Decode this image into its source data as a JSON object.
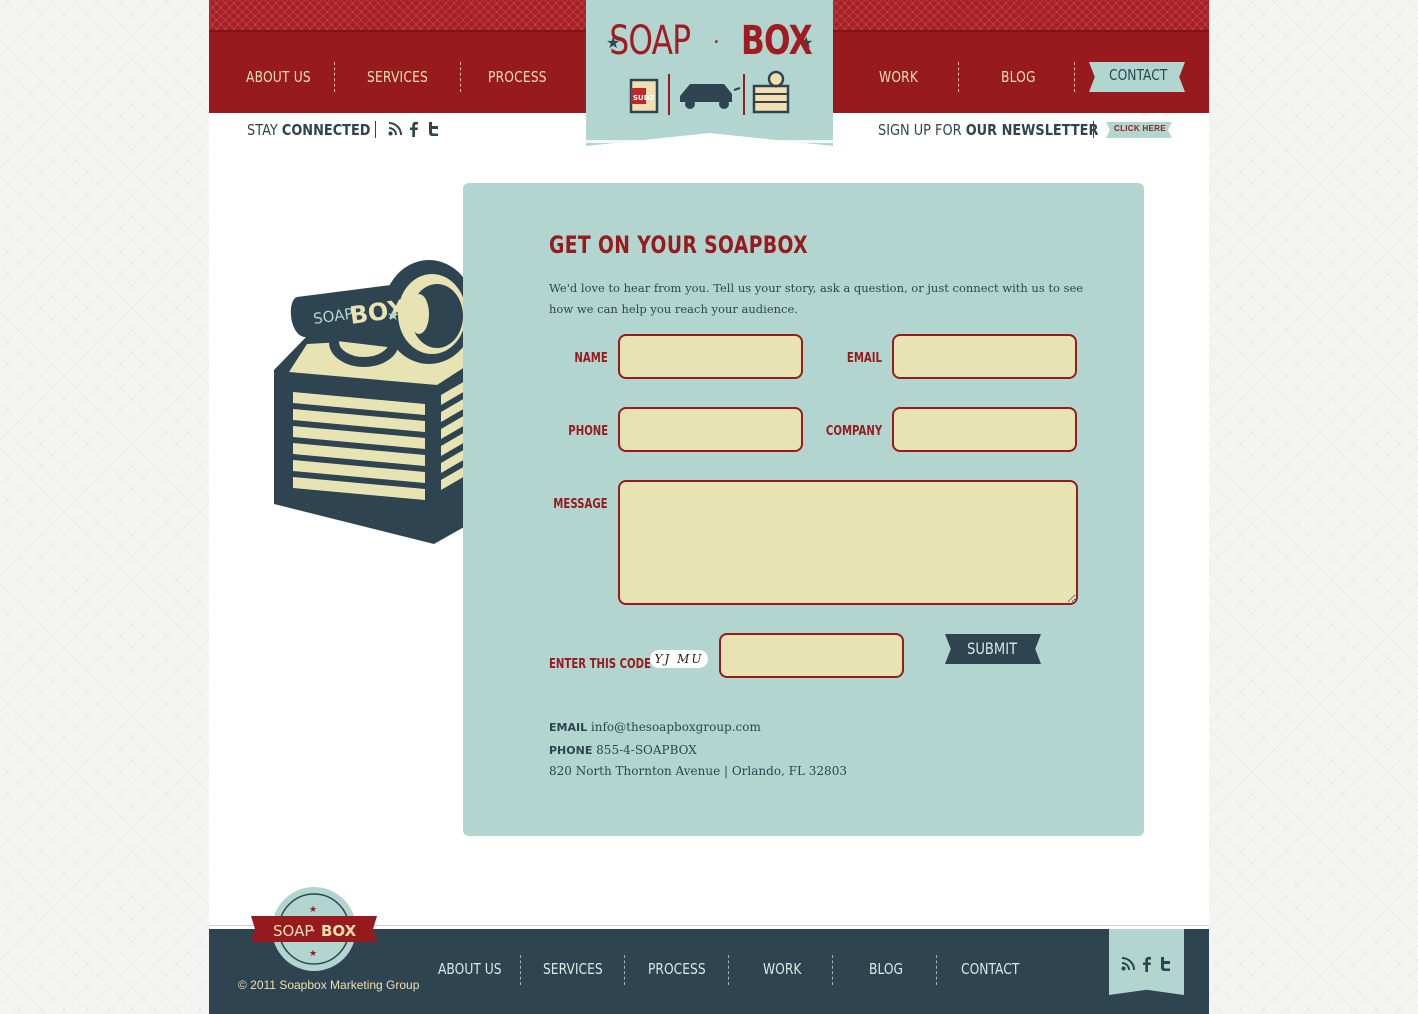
{
  "header": {
    "nav_left": [
      "ABOUT US",
      "SERVICES",
      "PROCESS"
    ],
    "nav_right": [
      "WORK",
      "BLOG"
    ],
    "contact_label": "CONTACT",
    "logo": {
      "left": "SOAP",
      "dot": "·",
      "right": "BOX",
      "product_label": "SUDZ"
    },
    "stay_prefix": "STAY ",
    "stay_bold": "CONNECTED",
    "newsletter_prefix": "SIGN UP FOR ",
    "newsletter_bold": "OUR NEWSLETTER",
    "click_here": "CLICK HERE"
  },
  "illustration": {
    "megaphone_left": "SOAP",
    "megaphone_right": "BOX"
  },
  "contact": {
    "heading": "GET ON YOUR SOAPBOX",
    "intro": "We'd love to hear from you. Tell us your story, ask a question, or just connect with us to see how we can help you reach your audience.",
    "fields": {
      "name": {
        "label": "NAME",
        "value": ""
      },
      "email": {
        "label": "EMAIL",
        "value": ""
      },
      "phone": {
        "label": "PHONE",
        "value": ""
      },
      "company": {
        "label": "COMPANY",
        "value": ""
      },
      "message": {
        "label": "MESSAGE",
        "value": ""
      },
      "code": {
        "label": "ENTER THIS CODE",
        "value": ""
      }
    },
    "captcha": "YJ MU",
    "submit_label": "SUBMIT",
    "info": {
      "email_label": "EMAIL",
      "email": "info@thesoapboxgroup.com",
      "phone_label": "PHONE",
      "phone": "855-4-SOAPBOX",
      "address": "820 North Thornton Avenue | Orlando, FL 32803"
    }
  },
  "footer": {
    "logo_left": "SOAP",
    "logo_dot": "·",
    "logo_right": "BOX",
    "nav": [
      "ABOUT US",
      "SERVICES",
      "PROCESS",
      "WORK",
      "BLOG",
      "CONTACT"
    ],
    "copyright": "© 2011 Soapbox Marketing Group"
  },
  "colors": {
    "red": "#961a1e",
    "teal": "#b2d6cf",
    "navy": "#2e4450",
    "cream": "#e8e3b3"
  },
  "icons": [
    "rss-icon",
    "facebook-icon",
    "twitter-icon"
  ]
}
